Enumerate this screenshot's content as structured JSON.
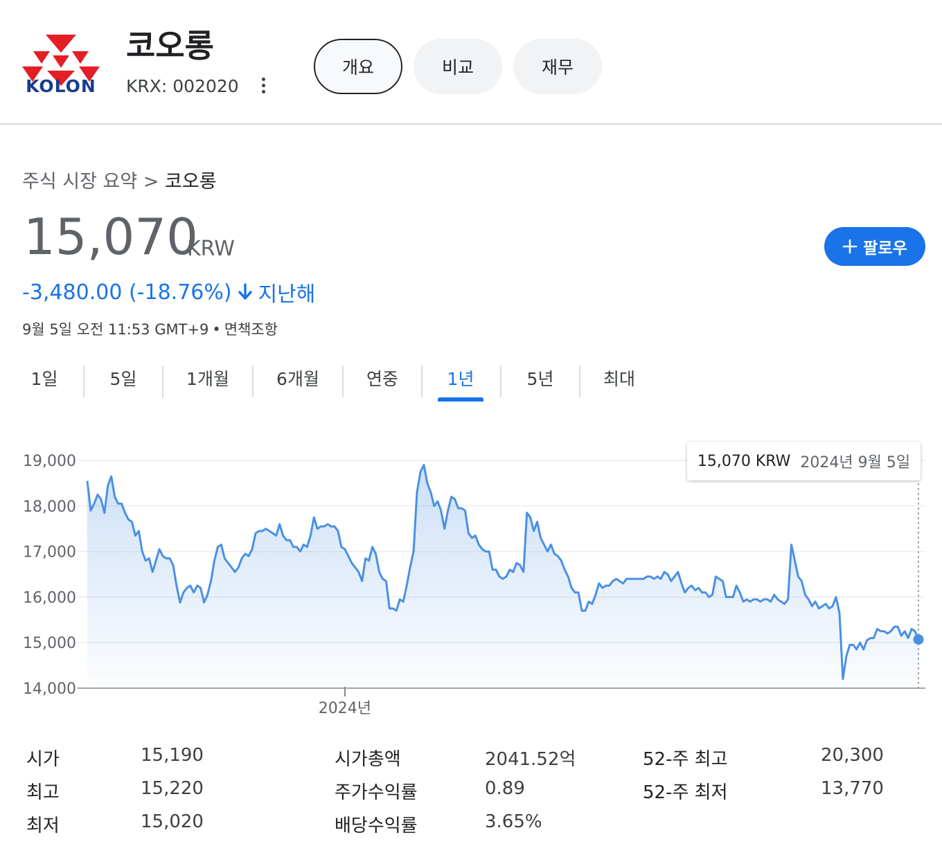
{
  "header": {
    "company_name": "코오롱",
    "ticker": "KRX: 002020",
    "logo_text": "KOLON",
    "tabs": [
      {
        "label": "개요",
        "active": true
      },
      {
        "label": "비교",
        "active": false
      },
      {
        "label": "재무",
        "active": false
      }
    ]
  },
  "breadcrumb": {
    "parent": "주식 시장 요약",
    "separator": ">",
    "current": "코오롱"
  },
  "quote": {
    "price": "15,070",
    "currency": "KRW",
    "change": "-3,480.00 (-18.76%)",
    "change_period": "지난해",
    "timestamp": "9월 5일 오전 11:53 GMT+9",
    "disclaimer": "면책조항"
  },
  "follow_button": {
    "label": "팔로우"
  },
  "ranges": [
    {
      "label": "1일",
      "active": false
    },
    {
      "label": "5일",
      "active": false
    },
    {
      "label": "1개월",
      "active": false
    },
    {
      "label": "6개월",
      "active": false
    },
    {
      "label": "연중",
      "active": false
    },
    {
      "label": "1년",
      "active": true
    },
    {
      "label": "5년",
      "active": false
    },
    {
      "label": "최대",
      "active": false
    }
  ],
  "tooltip": {
    "price": "15,070 KRW",
    "date": "2024년 9월 5일"
  },
  "chart_data": {
    "type": "area",
    "title": "",
    "xlabel": "",
    "ylabel": "",
    "ylim": [
      14000,
      19000
    ],
    "y_ticks": [
      "19,000",
      "18,000",
      "17,000",
      "16,000",
      "15,000",
      "14,000"
    ],
    "x_tick_labels": [
      {
        "label": "2024년",
        "index": 75
      }
    ],
    "grid": true,
    "color": "#4a90e2",
    "series": [
      {
        "values": [
          18550,
          17900,
          18050,
          18250,
          18150,
          17850,
          18450,
          18650,
          18200,
          18050,
          18050,
          17850,
          17700,
          17650,
          17350,
          17450,
          17000,
          16800,
          16850,
          16550,
          16800,
          17050,
          16900,
          16850,
          16850,
          16700,
          16250,
          15880,
          16100,
          16200,
          16250,
          16100,
          16250,
          16200,
          15880,
          16050,
          16350,
          16800,
          17100,
          17150,
          16850,
          16750,
          16650,
          16550,
          16650,
          16850,
          16950,
          16900,
          17050,
          17400,
          17450,
          17450,
          17500,
          17450,
          17400,
          17350,
          17600,
          17350,
          17250,
          17250,
          17100,
          17100,
          17000,
          17150,
          17100,
          17350,
          17750,
          17500,
          17550,
          17550,
          17600,
          17550,
          17550,
          17450,
          17100,
          17050,
          16900,
          16750,
          16650,
          16550,
          16350,
          16850,
          16800,
          17100,
          16950,
          16550,
          16400,
          16350,
          15750,
          15750,
          15700,
          15950,
          15900,
          16250,
          16650,
          17000,
          18300,
          18750,
          18900,
          18500,
          18300,
          18000,
          18100,
          17900,
          17500,
          17900,
          18200,
          18150,
          17950,
          17950,
          17900,
          17400,
          17300,
          17350,
          17150,
          17050,
          17000,
          17000,
          16600,
          16600,
          16450,
          16400,
          16450,
          16600,
          16550,
          16750,
          16700,
          16550,
          17850,
          17750,
          17450,
          17650,
          17300,
          17150,
          17000,
          17150,
          16950,
          16900,
          16800,
          16600,
          16450,
          16200,
          16100,
          16100,
          15700,
          15700,
          15900,
          15850,
          16050,
          16300,
          16200,
          16250,
          16250,
          16350,
          16400,
          16350,
          16300,
          16400,
          16400,
          16400,
          16400,
          16400,
          16400,
          16450,
          16450,
          16400,
          16450,
          16400,
          16550,
          16500,
          16350,
          16450,
          16550,
          16300,
          16100,
          16200,
          16250,
          16150,
          16200,
          16100,
          16100,
          16000,
          16050,
          16450,
          16400,
          16350,
          16000,
          16000,
          16000,
          16250,
          16100,
          15900,
          15950,
          15900,
          15950,
          15950,
          15900,
          15950,
          15950,
          15900,
          16050,
          15950,
          15900,
          15850,
          15950,
          17150,
          16800,
          16450,
          16350,
          16050,
          15950,
          15800,
          15900,
          15750,
          15800,
          15850,
          15750,
          15800,
          16000,
          15650,
          14200,
          14700,
          14950,
          14950,
          14850,
          15000,
          14850,
          15050,
          15100,
          15100,
          15300,
          15250,
          15250,
          15200,
          15250,
          15350,
          15350,
          15150,
          15250,
          15100,
          15300,
          15250,
          15070
        ]
      }
    ]
  },
  "stats": [
    {
      "label": "시가",
      "value": "15,190"
    },
    {
      "label": "최고",
      "value": "15,220"
    },
    {
      "label": "최저",
      "value": "15,020"
    },
    {
      "label": "시가총액",
      "value": "2041.52억"
    },
    {
      "label": "주가수익률",
      "value": "0.89"
    },
    {
      "label": "배당수익률",
      "value": "3.65%"
    },
    {
      "label": "52-주 최고",
      "value": "20,300"
    },
    {
      "label": "52-주 최저",
      "value": "13,770"
    }
  ]
}
